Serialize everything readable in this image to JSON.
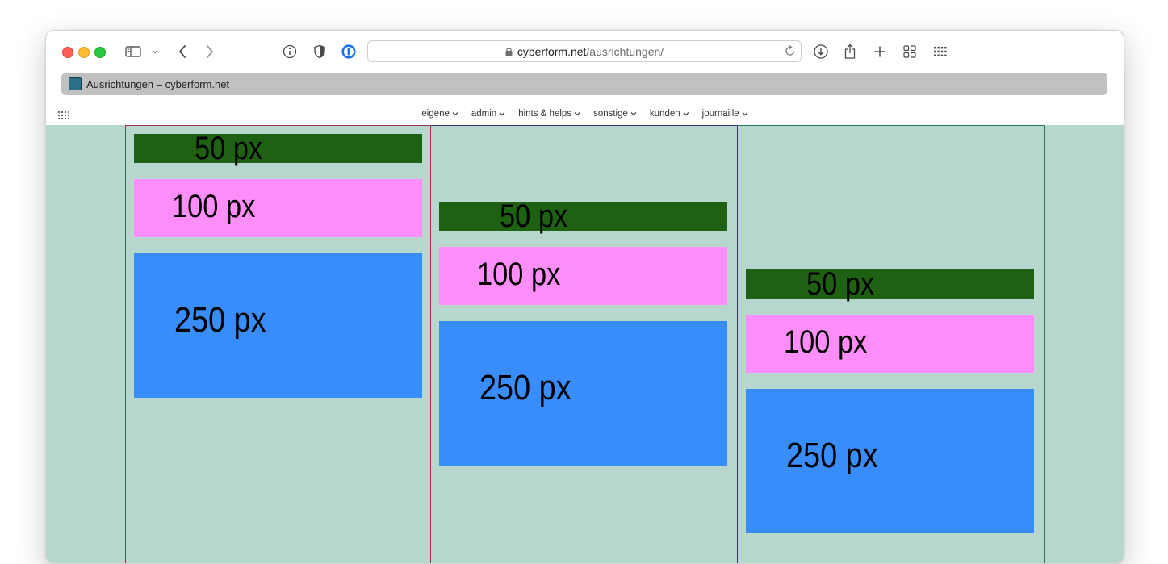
{
  "browser": {
    "url_domain": "cyberform.net",
    "url_path": "/ausrichtungen/",
    "tab_title": "Ausrichtungen – cyberform.net"
  },
  "nav": {
    "items": [
      "eigene",
      "admin",
      "hints & helps",
      "sonstige",
      "kunden",
      "journaille"
    ]
  },
  "columns": [
    {
      "alignment": "top",
      "boxes": [
        {
          "label": "50 px",
          "color": "#1e6113"
        },
        {
          "label": "100 px",
          "color": "#ff8dfa"
        },
        {
          "label": "250 px",
          "color": "#388dfb"
        }
      ]
    },
    {
      "alignment": "center",
      "boxes": [
        {
          "label": "50 px",
          "color": "#1e6113"
        },
        {
          "label": "100 px",
          "color": "#ff8dfa"
        },
        {
          "label": "250 px",
          "color": "#388dfb"
        }
      ]
    },
    {
      "alignment": "bottom",
      "boxes": [
        {
          "label": "50 px",
          "color": "#1e6113"
        },
        {
          "label": "100 px",
          "color": "#ff8dfa"
        },
        {
          "label": "250 px",
          "color": "#388dfb"
        }
      ]
    }
  ],
  "colors": {
    "page_background": "#b7d6cd",
    "column1_border": "#9b2f4d",
    "column2_border": "#3c2f83",
    "column3_border": "#2b7a4b"
  },
  "icons": [
    "sidebar-icon",
    "chevron-down-icon",
    "back-icon",
    "forward-icon",
    "info-icon",
    "shield-icon",
    "password-manager-icon",
    "lock-icon",
    "reload-icon",
    "download-icon",
    "share-icon",
    "new-tab-icon",
    "tab-overview-icon",
    "apps-grid-icon"
  ]
}
